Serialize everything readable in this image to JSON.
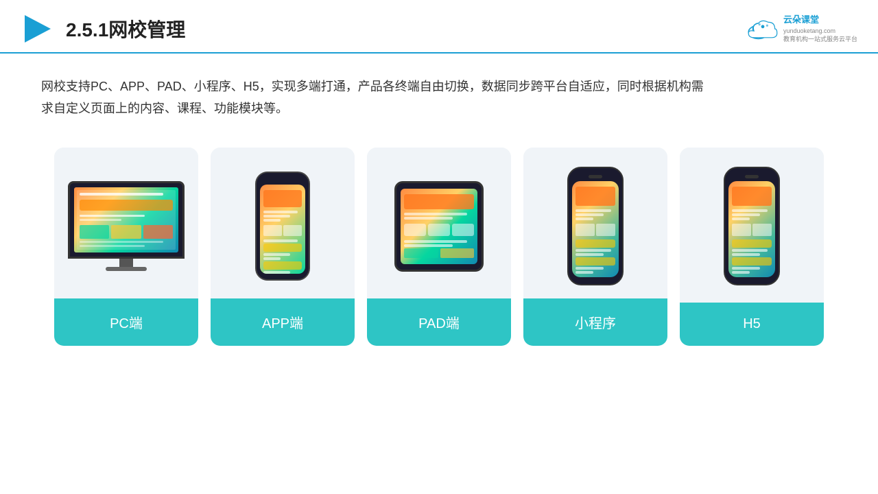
{
  "header": {
    "title": "2.5.1网校管理",
    "brand": {
      "name": "云朵课堂",
      "domain": "yunduoketang.com",
      "tagline": "教育机构一站式服务云平台"
    }
  },
  "description": {
    "text": "网校支持PC、APP、PAD、小程序、H5，实现多端打通，产品各终端自由切换，数据同步跨平台自适应，同时根据机构需求自定义页面上的内容、课程、功能模块等。"
  },
  "cards": [
    {
      "id": "pc",
      "label": "PC端",
      "device": "pc"
    },
    {
      "id": "app",
      "label": "APP端",
      "device": "phone"
    },
    {
      "id": "pad",
      "label": "PAD端",
      "device": "pad"
    },
    {
      "id": "mini",
      "label": "小程序",
      "device": "phone-modern"
    },
    {
      "id": "h5",
      "label": "H5",
      "device": "phone-modern"
    }
  ],
  "colors": {
    "accent": "#2ec5c5",
    "header_line": "#1a9fd4",
    "card_bg": "#f0f4f8"
  }
}
